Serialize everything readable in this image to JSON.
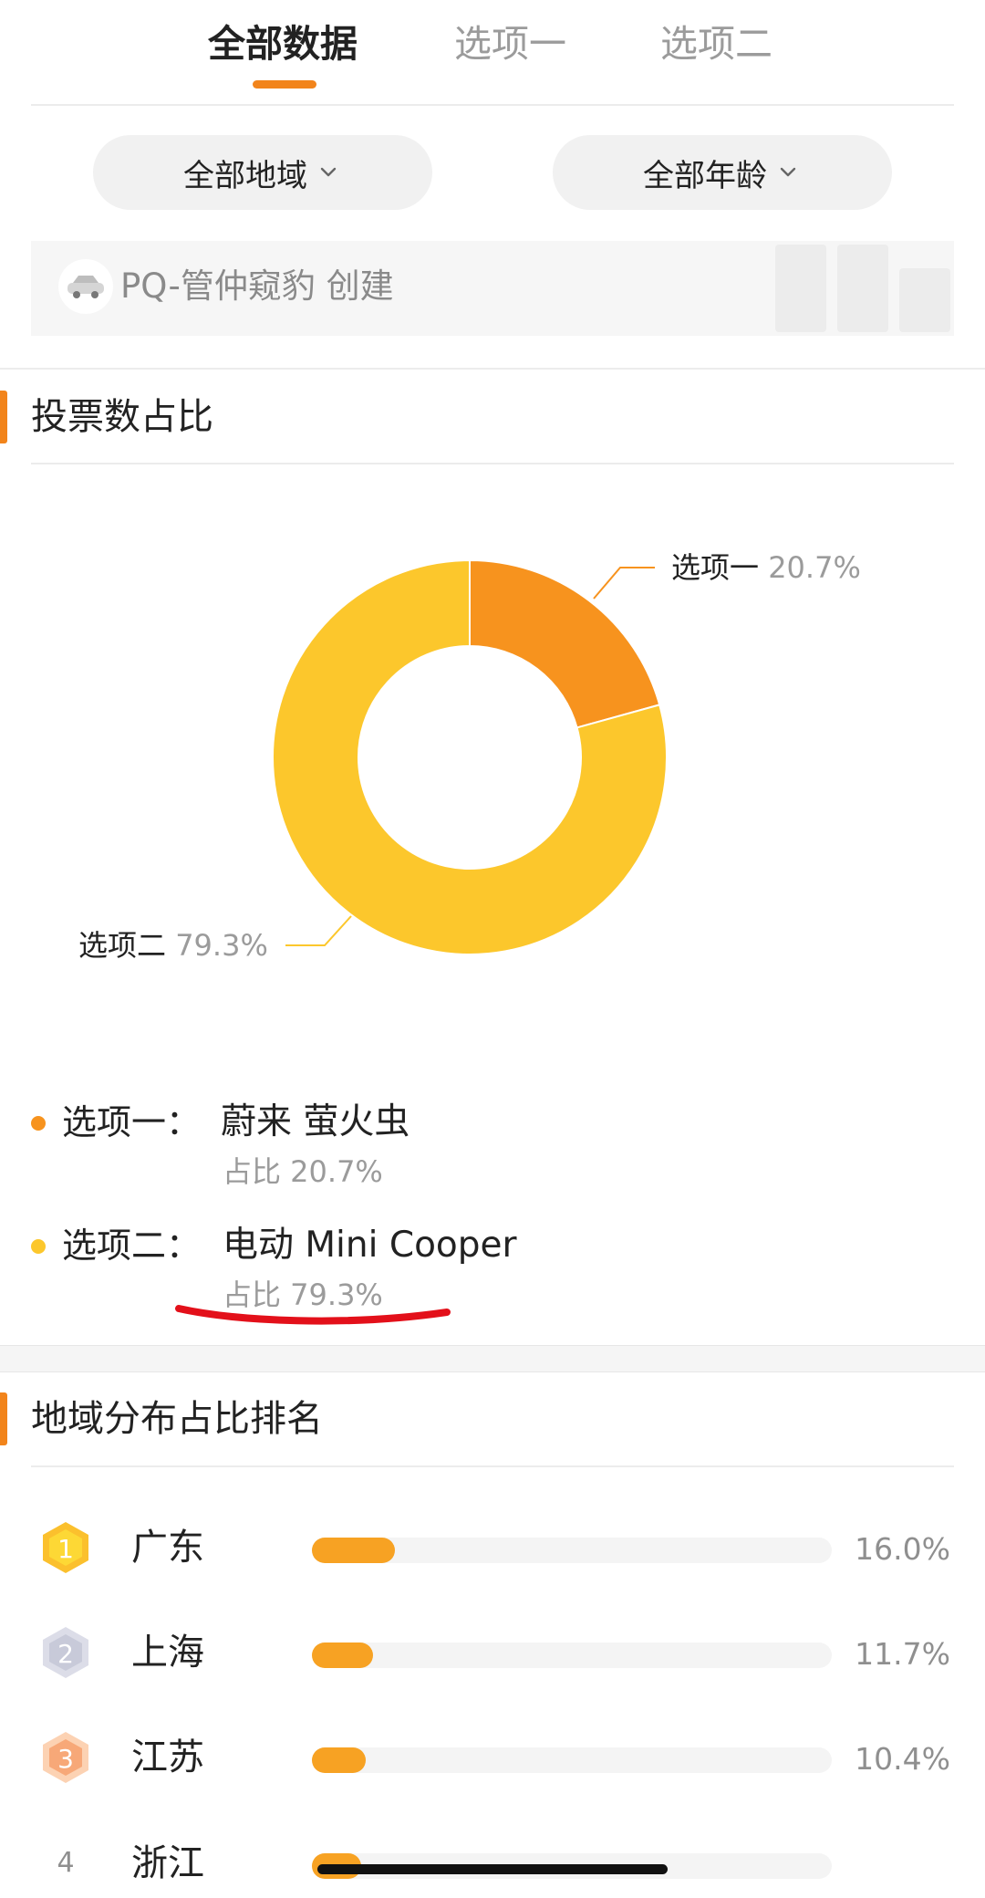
{
  "tabs": [
    {
      "label": "全部数据",
      "active": true
    },
    {
      "label": "选项一",
      "active": false
    },
    {
      "label": "选项二",
      "active": false
    }
  ],
  "filters": {
    "region": "全部地域",
    "age": "全部年龄"
  },
  "creator": {
    "text": "PQ-管仲窥豹 创建"
  },
  "vote_section": {
    "title": "投票数占比"
  },
  "chart_data": {
    "type": "pie",
    "donut": true,
    "slices": [
      {
        "label": "选项一",
        "value": 20.7,
        "display": "20.7%",
        "color": "#f7931e"
      },
      {
        "label": "选项二",
        "value": 79.3,
        "display": "79.3%",
        "color": "#fcc72c"
      }
    ]
  },
  "legend": [
    {
      "option": "选项一：",
      "name": "蔚来 萤火虫",
      "share": "占比 20.7%",
      "color": "#f7931e"
    },
    {
      "option": "选项二：",
      "name": "电动 Mini Cooper",
      "share": "占比 79.3%",
      "color": "#fcc72c"
    }
  ],
  "region_section": {
    "title": "地域分布占比排名"
  },
  "regions": [
    {
      "rank": "1",
      "name": "广东",
      "percent": 16.0,
      "label": "16.0%"
    },
    {
      "rank": "2",
      "name": "上海",
      "percent": 11.7,
      "label": "11.7%"
    },
    {
      "rank": "3",
      "name": "江苏",
      "percent": 10.4,
      "label": "10.4%"
    },
    {
      "rank": "4",
      "name": "浙江",
      "percent": 9.4,
      "label": ""
    }
  ]
}
